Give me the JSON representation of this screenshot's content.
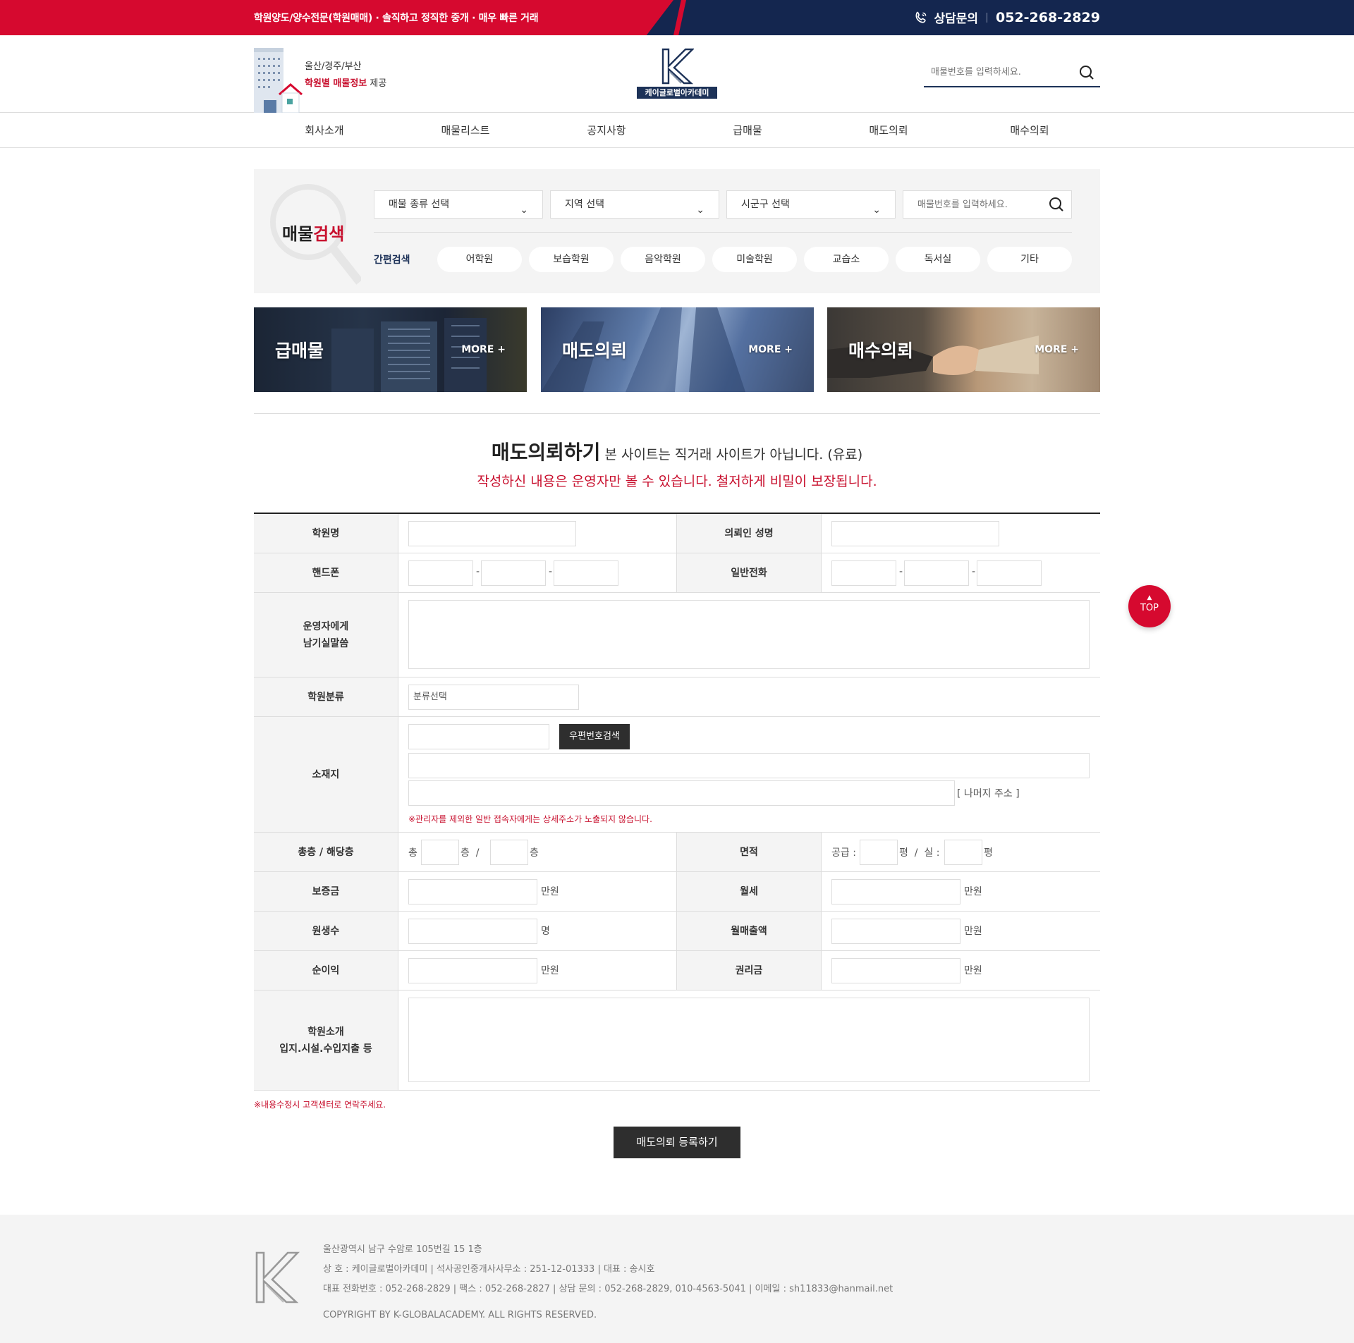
{
  "topbar": {
    "slogan": "학원양도/양수전문(학원매매) · 솔직하고 정직한 중개 · 매우 빠른 거래",
    "call_label": "상담문의",
    "phone": "052-268-2829"
  },
  "header": {
    "region": "울산/경주/부산",
    "tag_highlight": "학원별 매물정보",
    "tag_rest": " 제공",
    "logo_text": "케이글로벌아카데미",
    "search_placeholder": "매물번호를 입력하세요."
  },
  "nav": [
    "회사소개",
    "매물리스트",
    "공지사항",
    "급매물",
    "매도의뢰",
    "매수의뢰"
  ],
  "search_box": {
    "title_a": "매물",
    "title_b": "검색",
    "select1": "매물 종류 선택",
    "select2": "지역 선택",
    "select3": "시군구 선택",
    "placeholder": "매물번호를 입력하세요.",
    "quick_label": "간편검색",
    "chips": [
      "어학원",
      "보습학원",
      "음악학원",
      "미술학원",
      "교습소",
      "독서실",
      "기타"
    ]
  },
  "banners": [
    {
      "title": "급매물",
      "more": "MORE +"
    },
    {
      "title": "매도의뢰",
      "more": "MORE +"
    },
    {
      "title": "매수의뢰",
      "more": "MORE +"
    }
  ],
  "form": {
    "title": "매도의뢰하기",
    "title_note": " 본 사이트는 직거래 사이트가 아닙니다. (유료)",
    "subtitle": "작성하신 내용은 운영자만 볼 수 있습니다. 철저하게 비밀이 보장됩니다.",
    "labels": {
      "academy_name": "학원명",
      "requester": "의뢰인 성명",
      "mobile": "핸드폰",
      "phone": "일반전화",
      "message_1": "운영자에게",
      "message_2": "남기실말씀",
      "category": "학원분류",
      "address": "소재지",
      "floors": "총층 / 해당층",
      "area": "면적",
      "deposit": "보증금",
      "rent": "월세",
      "students": "원생수",
      "monthly_sales": "월매출액",
      "net_profit": "순이익",
      "premium": "권리금",
      "intro_1": "학원소개",
      "intro_2": "입지.시설.수입지출 등"
    },
    "category_value": "분류선택",
    "zip_button": "우편번호검색",
    "rest_address": "[ 나머지 주소 ]",
    "address_note": "※관리자를 제외한 일반 접속자에게는 상세주소가 노출되지 않습니다.",
    "floor_total": "총",
    "floor_unit1": "층  /",
    "floor_unit2": "층",
    "area_supply": "공급 :",
    "area_unit1": "평  /  실 :",
    "area_unit2": "평",
    "unit_won": "만원",
    "unit_people": "명",
    "dash": "-",
    "footnote": "※내용수정시 고객센터로 연락주세요.",
    "submit": "매도의뢰 등록하기"
  },
  "top_button": "TOP",
  "footer": {
    "address": "울산광역시 남구 수암로 105번길 15 1층",
    "company": "상 호 : 케이글로벌아카데미 | 석사공인중개사사무소 : 251-12-01333  |  대표 : 송시호",
    "contact": "대표 전화번호 : 052-268-2829  |  팩스 : 052-268-2827  |  상담 문의 : 052-268-2829, 010-4563-5041 | 이메일 : sh11833@hanmail.net",
    "copyright": "COPYRIGHT BY K-GLOBALACADEMY. ALL RIGHTS RESERVED."
  },
  "colors": {
    "red": "#d6092f",
    "navy": "#14264f",
    "dark_button": "#2e2e2e"
  }
}
